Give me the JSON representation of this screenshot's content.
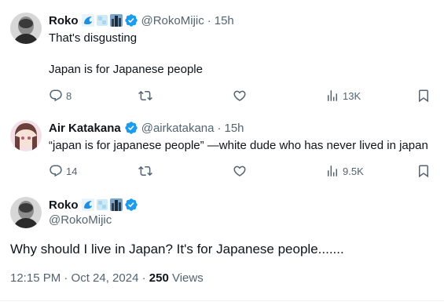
{
  "tweets": [
    {
      "name": "Roko",
      "handle": "@RokoMijic",
      "time": "15h",
      "lines": [
        "That's disgusting",
        "Japan is for Japanese people"
      ],
      "replies": "8",
      "views": "13K"
    },
    {
      "name": "Air Katakana",
      "handle": "@airkatakana",
      "time": "15h",
      "lines": [
        "“japan is for japanese people” —white dude who has never lived in japan"
      ],
      "replies": "14",
      "views": "9.5K"
    }
  ],
  "main": {
    "name": "Roko",
    "handle": "@RokoMijic",
    "text": "Why should I live in Japan? It's for Japanese people.......",
    "timestamp": "12:15 PM · Oct 24, 2024 ·",
    "views_count": "250",
    "views_label": "Views"
  },
  "separator": "·",
  "colors": {
    "verified": "#1d9bf0",
    "muted": "#536471",
    "text": "#0f1419"
  },
  "icons": [
    "reply-icon",
    "retweet-icon",
    "like-icon",
    "views-icon",
    "bookmark-icon",
    "verified-badge-icon"
  ]
}
